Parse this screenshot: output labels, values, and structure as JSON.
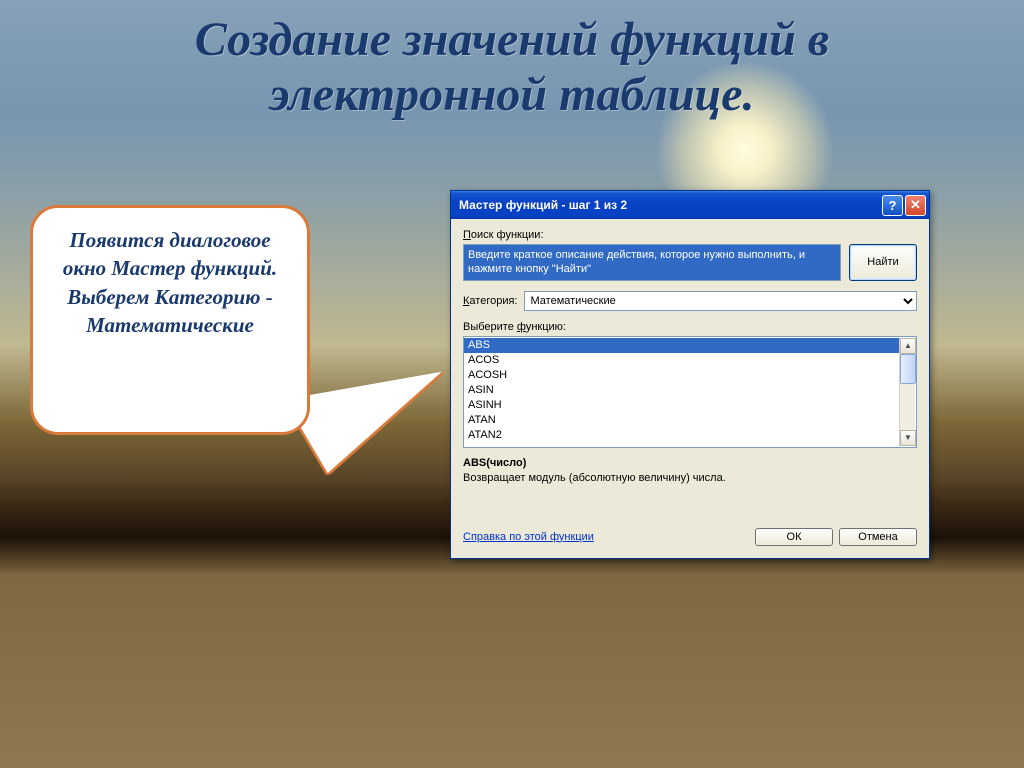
{
  "title": "Создание значений функций в электронной таблице.",
  "bubble_text": "Появится диалоговое окно Мастер функций. Выберем Категорию - Математические",
  "dialog": {
    "title": "Мастер функций - шаг 1 из 2",
    "search_label": "Поиск функции:",
    "search_value": "Введите краткое описание действия, которое нужно выполнить, и нажмите кнопку \"Найти\"",
    "find_button": "Найти",
    "category_label": "Категория:",
    "category_value": "Математические",
    "select_label": "Выберите функцию:",
    "functions": [
      "ABS",
      "ACOS",
      "ACOSH",
      "ASIN",
      "ASINH",
      "ATAN",
      "ATAN2"
    ],
    "signature": "ABS(число)",
    "description": "Возвращает модуль (абсолютную величину) числа.",
    "help_link": "Справка по этой функции",
    "ok": "ОК",
    "cancel": "Отмена"
  }
}
